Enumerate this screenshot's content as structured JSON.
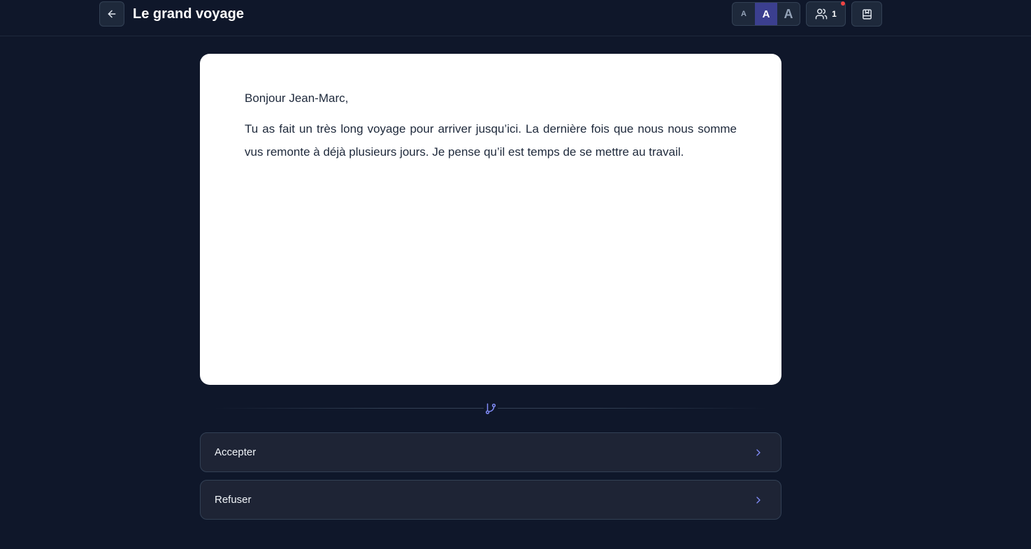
{
  "header": {
    "title": "Le grand voyage",
    "back_icon": "arrow-left-icon",
    "font_size_options": [
      "A",
      "A",
      "A"
    ],
    "font_size_selected": "medium",
    "players_count": "1",
    "players_icon": "users-icon",
    "bookmark_icon": "bookmark-icon"
  },
  "story": {
    "greeting": "Bonjour Jean-Marc,",
    "paragraph": "Tu as fait un très long voyage pour arriver jusqu’ici. La dernière fois que nous nous somme vus remonte à déjà plusieurs jours. Je pense qu’il est temps de se mettre au travail."
  },
  "divider_icon": "git-branch-icon",
  "choices": [
    {
      "label": "Accepter",
      "icon": "chevron-right-icon"
    },
    {
      "label": "Refuser",
      "icon": "chevron-right-icon"
    }
  ],
  "colors": {
    "background": "#0f172a",
    "accent": "#818cf8",
    "selected": "#3b3f8f",
    "notification": "#ef4444"
  }
}
